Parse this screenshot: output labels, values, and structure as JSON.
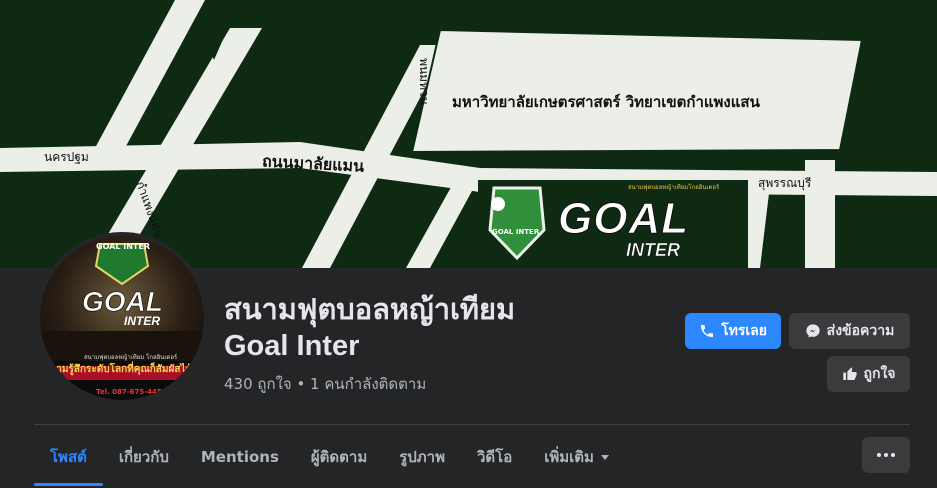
{
  "cover": {
    "map_labels": {
      "university": "มหาวิทยาลัยเกษตรศาสตร์ วิทยาเขตกำแพงแสน",
      "road_main": "ถนนมาลัยแมน",
      "road_left": "นครปฐม",
      "road_right": "สุพรรณบุรี",
      "road_vertical_top": "พนมทวน",
      "road_vertical_left": "กำแพงแสน",
      "logo_text_1": "GOAL",
      "logo_text_2": "INTER",
      "logo_badge": "GOAL INTER",
      "logo_caption": "สนามฟุตบอลหญ้าเทียมโกลอินเตอร์"
    }
  },
  "avatar": {
    "badge_text": "GOAL INTER",
    "title_1": "GOAL",
    "title_2": "INTER",
    "line_small": "สนามฟุตบอลหญ้าเทียม โกลอินเตอร์",
    "tagline": "ความรู้สึกระดับโลกที่คุณก็สัมผัสได้",
    "phone": "Tel. 087-675-4451"
  },
  "page": {
    "name_line_1": "สนามฟุตบอลหญ้าเทียม",
    "name_line_2": "Goal Inter",
    "stats": "430 ถูกใจ • 1 คนกำลังติดตาม"
  },
  "actions": {
    "call_label": "โทรเลย",
    "message_label": "ส่งข้อความ",
    "like_label": "ถูกใจ"
  },
  "tabs": [
    {
      "label": "โพสต์",
      "active": true
    },
    {
      "label": "เกี่ยวกับ"
    },
    {
      "label": "Mentions"
    },
    {
      "label": "ผู้ติดตาม"
    },
    {
      "label": "รูปภาพ"
    },
    {
      "label": "วิดีโอ"
    },
    {
      "label": "เพิ่มเติม"
    }
  ],
  "colors": {
    "accent": "#2d88ff",
    "background": "#242526",
    "surface": "#3a3b3c",
    "cover_green": "#0f2a12"
  }
}
